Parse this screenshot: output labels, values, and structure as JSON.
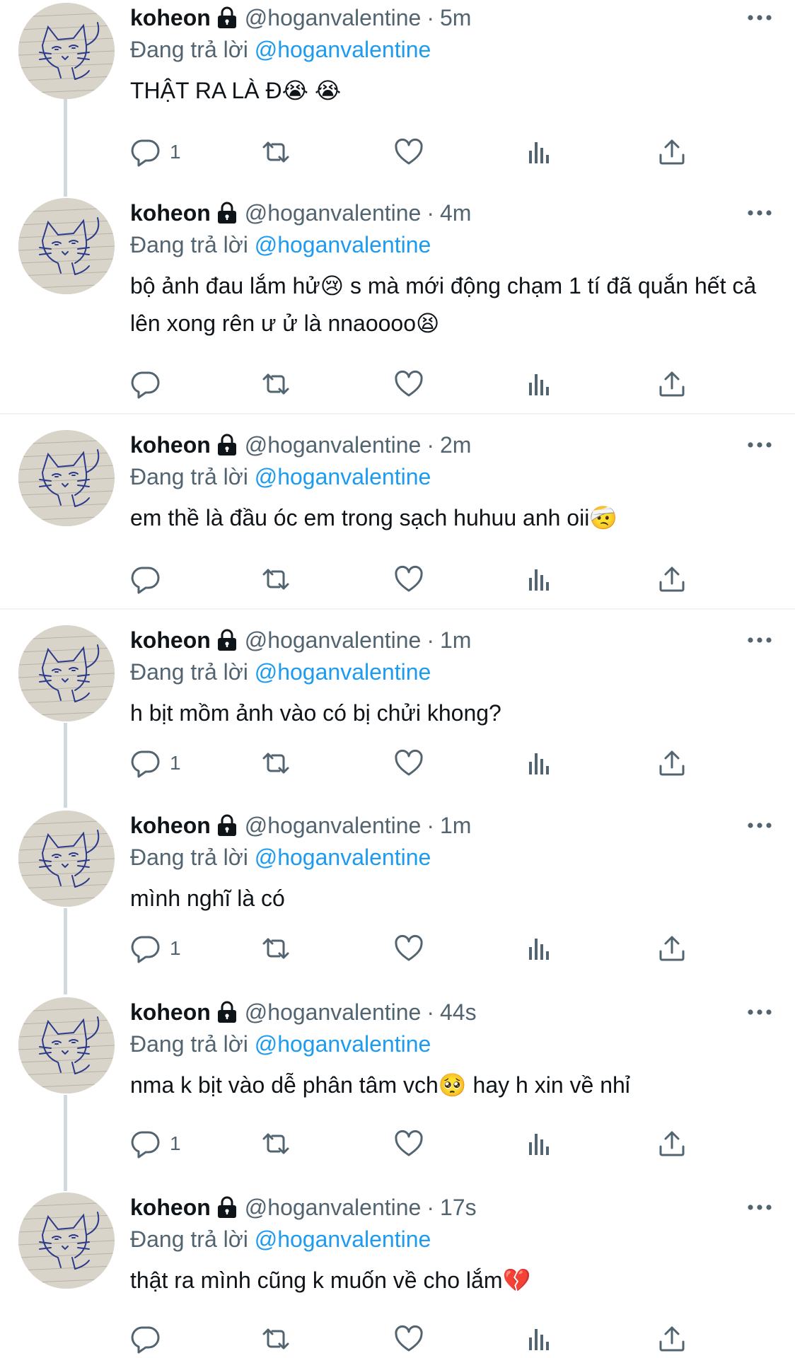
{
  "author": {
    "name": "koheon",
    "handle": "@hoganvalentine"
  },
  "reply_prefix": "Đang trả lời",
  "icons": {
    "lock": "lock-icon",
    "more": "more-icon",
    "reply": "reply-icon",
    "retweet": "retweet-icon",
    "like": "like-icon",
    "views": "views-icon",
    "share": "share-icon"
  },
  "colors": {
    "mention": "#1d9bf0",
    "secondary": "#536471",
    "text": "#0f1419"
  },
  "tweets": [
    {
      "time": "5m",
      "reply_to": "@hoganvalentine",
      "text": "THẬT RA LÀ Đ😭 😭",
      "reply_count": "1"
    },
    {
      "time": "4m",
      "reply_to": "@hoganvalentine",
      "text": "bộ ảnh đau lắm hử😢 s mà mới động chạm 1 tí đã quắn hết cả lên xong rên ư ử là nnaoooo😫",
      "reply_count": ""
    },
    {
      "time": "2m",
      "reply_to": "@hoganvalentine",
      "text": "em thề là đầu óc em trong sạch huhuu anh oii🤕",
      "reply_count": ""
    },
    {
      "time": "1m",
      "reply_to": "@hoganvalentine",
      "text": "h bịt mồm ảnh vào có bị chửi khong?",
      "reply_count": "1"
    },
    {
      "time": "1m",
      "reply_to": "@hoganvalentine",
      "text": "mình nghĩ là có",
      "reply_count": "1"
    },
    {
      "time": "44s",
      "reply_to": "@hoganvalentine",
      "text": "nma k bịt vào dễ phân tâm vch🥺 hay h xin về nhỉ",
      "reply_count": "1"
    },
    {
      "time": "17s",
      "reply_to": "@hoganvalentine",
      "text": "thật ra mình cũng k muốn về cho lắm💔",
      "reply_count": ""
    }
  ]
}
